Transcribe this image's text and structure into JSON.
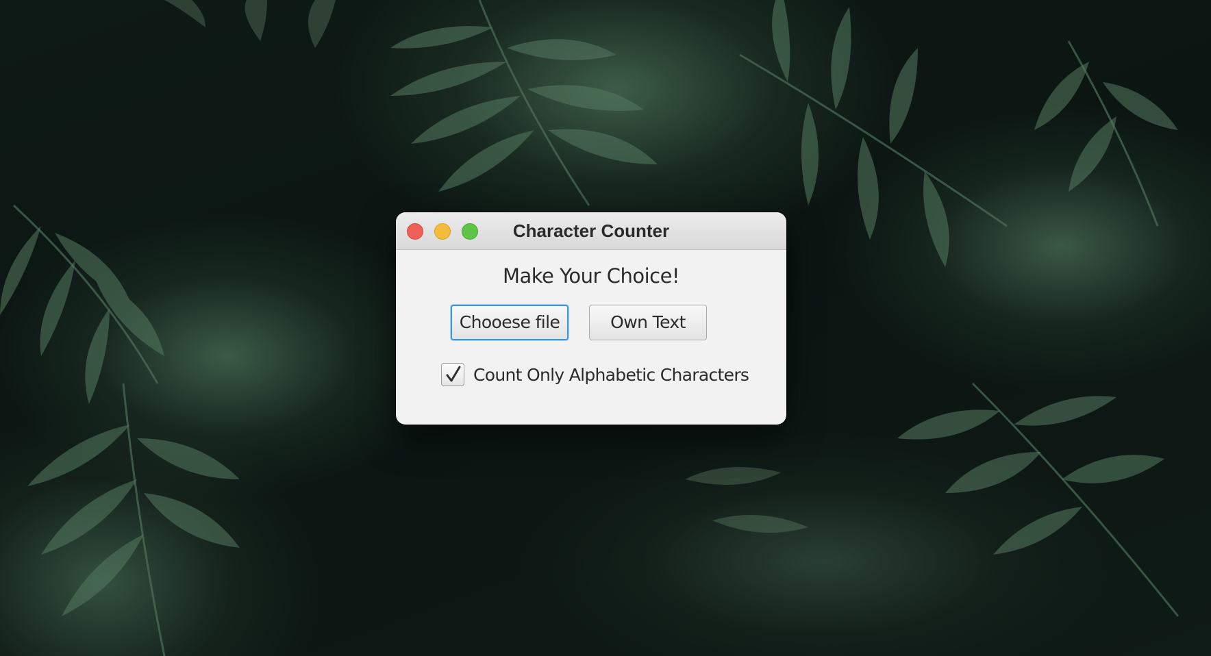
{
  "window": {
    "title": "Character Counter",
    "controls": {
      "close": "close-icon",
      "minimize": "minimize-icon",
      "zoom": "zoom-icon"
    }
  },
  "content": {
    "heading": "Make Your Choice!",
    "buttons": {
      "choose_file": "Chooese file",
      "own_text": "Own Text"
    },
    "checkbox": {
      "label": "Count Only Alphabetic Characters",
      "checked": true
    }
  },
  "colors": {
    "close": "#ee5f57",
    "minimize": "#f4bc3a",
    "zoom": "#5ec547",
    "focus_ring": "#3a98d6"
  }
}
